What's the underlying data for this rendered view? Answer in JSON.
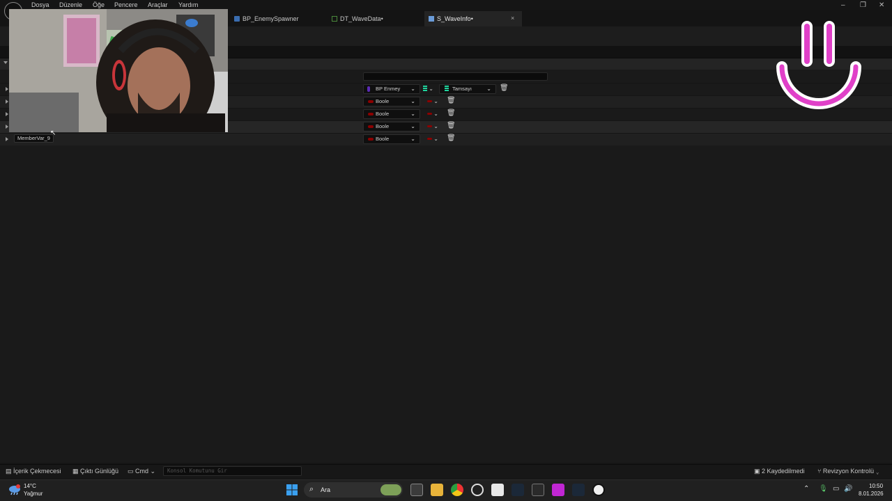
{
  "menu": {
    "items": [
      "Dosya",
      "Düzenle",
      "Öğe",
      "Pencere",
      "Araçlar",
      "Yardım"
    ]
  },
  "window_controls": {
    "minimize": "–",
    "maximize": "❐",
    "close": "✕"
  },
  "tabs": [
    {
      "label": "BP_EnemySpawner",
      "active": false
    },
    {
      "label": "DT_WaveData•",
      "active": false
    },
    {
      "label": "S_WaveInfo•",
      "active": true
    }
  ],
  "tab_close": "×",
  "struct_members": [
    {
      "type": "BP Enmey",
      "type_color": "#5b2bb5",
      "value_type": "Tamsayı",
      "value_color": "#1fd59e"
    },
    {
      "type": "Boole",
      "type_color": "#8b0000"
    },
    {
      "type": "Boole",
      "type_color": "#8b0000"
    },
    {
      "type": "Boole",
      "type_color": "#8b0000"
    },
    {
      "type": "Boole",
      "type_color": "#8b0000"
    }
  ],
  "member_tooltip": "MemberVar_9",
  "icons": {
    "chevron": "⌄",
    "trash": "🗑",
    "map_container": "map-container-icon"
  },
  "statusbar": {
    "content_drawer": "İçerik Çekmecesi",
    "output_log": "Çıktı Günlüğü",
    "cmd": "Cmd",
    "console_placeholder": "Konsol Komutunu Gir",
    "unsaved": "2 Kaydedilmedi",
    "revision": "Revizyon Kontrolü"
  },
  "taskbar": {
    "temperature": "14°C",
    "weather": "Yağmur",
    "search": "Ara",
    "time": "10:50",
    "date": "8.01.2026"
  },
  "colors": {
    "accent_smiley": "#e040c8",
    "boole": "#8b0000",
    "integer": "#1fd59e",
    "object": "#5b2bb5"
  }
}
